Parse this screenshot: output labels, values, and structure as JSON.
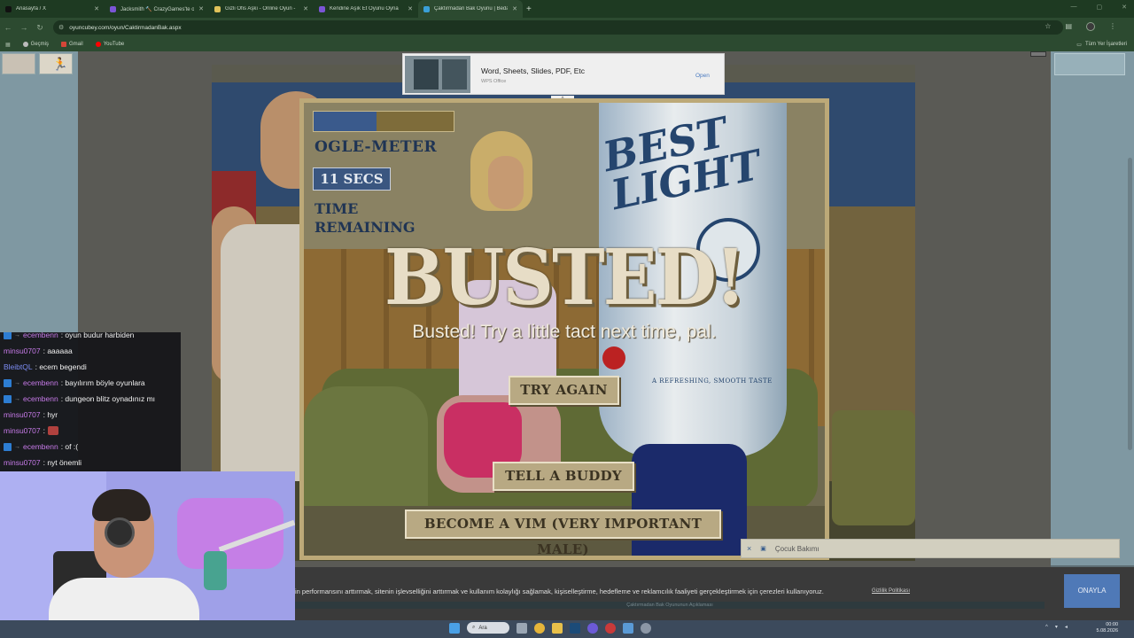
{
  "browser": {
    "tabs": [
      {
        "title": "Anasayfa / X",
        "color": "#111111"
      },
      {
        "title": "Jacksmith 🔨 CrazyGames'te o",
        "color": "#7b55d6"
      },
      {
        "title": "Gizli Ofis Aşkı - Online Oyun -",
        "color": "#e0c35a"
      },
      {
        "title": "Kendine Aşık Et Oyunu Oyna",
        "color": "#7b55d6"
      },
      {
        "title": "Çaktırmadan Bak Oyunu | Bedava",
        "color": "#3aa0d8",
        "active": true
      }
    ],
    "new_tab": "+",
    "url": "oyuncubey.com/oyun/CaktirmadanBak.aspx",
    "bookmarks": [
      {
        "label": "Geçmiş",
        "color": "#bbbbbb"
      },
      {
        "label": "Gmail",
        "color": "#d44638"
      },
      {
        "label": "YouTube",
        "color": "#ff0000"
      }
    ],
    "all_bookmarks": "Tüm Yer İşaretleri"
  },
  "ad": {
    "title": "Word, Sheets, Slides, PDF, Etc",
    "sponsor": "WPS Office",
    "cta": "Open",
    "collapse": "^"
  },
  "game": {
    "meter_label": "OGLE-METER",
    "meter_level": 0.45,
    "seconds": "11 SECS",
    "time_label_1": "TIME",
    "time_label_2": "REMAINING",
    "headline": "BUSTED!",
    "subline": "Busted! Try a little tact next time, pal.",
    "btn_try": "TRY AGAIN",
    "btn_buddy": "TELL A BUDDY",
    "btn_vim": "BECOME A VIM (VERY IMPORTANT MALE)",
    "can_logo": "BEST LIGHT",
    "can_text": "A REFRESHING, SMOOTH TASTE"
  },
  "toast": {
    "close": "×",
    "text": "Çocuk Bakımı"
  },
  "cookie": {
    "text": "in performansını arttırmak, sitenin işlevselliğini arttırmak ve kullanım kolaylığı sağlamak, kişiselleştirme, hedefleme ve reklamcılık faaliyeti gerçekleştirmek için çerezleri kullanıyoruz.",
    "link": "Gizlilik Politikası",
    "button": "ONAYLA",
    "strip": "Çaktırmadan Bak Oyununun Açıklaması"
  },
  "chat": {
    "messages": [
      {
        "user": "ecembenn",
        "text": ": oyun budur harbiden",
        "badge": true,
        "color": "pink"
      },
      {
        "user": "minsu0707",
        "text": ": aaaaaa",
        "badge": false,
        "color": "pink"
      },
      {
        "user": "BleibtQL",
        "text": ": ecem begendi",
        "badge": false,
        "color": "blue"
      },
      {
        "user": "ecembenn",
        "text": ": bayılırım böyle oyunlara",
        "badge": true,
        "color": "pink"
      },
      {
        "user": "ecembenn",
        "text": ": dungeon blitz oynadınız mı",
        "badge": true,
        "color": "pink"
      },
      {
        "user": "minsu0707",
        "text": ": hyr",
        "badge": false,
        "color": "pink"
      },
      {
        "user": "minsu0707",
        "text": ":",
        "badge": false,
        "color": "pink"
      },
      {
        "user": "ecembenn",
        "text": ": of :(",
        "badge": true,
        "color": "pink"
      },
      {
        "user": "minsu0707",
        "text": ": nyt önemli",
        "badge": false,
        "color": "pink"
      }
    ]
  },
  "taskbar": {
    "search": "Ara",
    "time": "00:00",
    "date": "5.08.2026"
  }
}
